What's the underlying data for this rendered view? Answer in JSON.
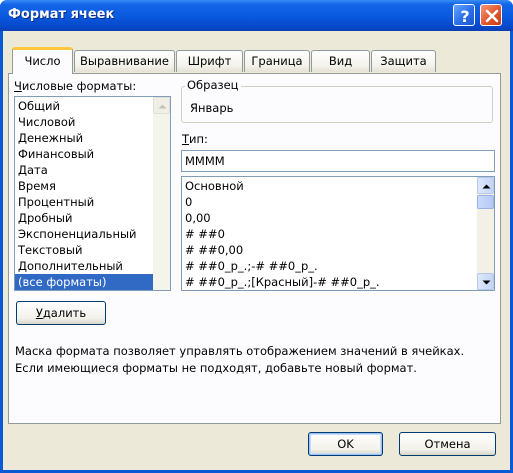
{
  "window": {
    "title": "Формат ячеек"
  },
  "titlebar": {
    "help_icon": "question-mark",
    "close_icon": "x-mark"
  },
  "tabs": [
    {
      "label": "Число",
      "active": true
    },
    {
      "label": "Выравнивание",
      "active": false
    },
    {
      "label": "Шрифт",
      "active": false
    },
    {
      "label": "Граница",
      "active": false
    },
    {
      "label": "Вид",
      "active": false
    },
    {
      "label": "Защита",
      "active": false
    }
  ],
  "number_formats": {
    "label_first": "Ч",
    "label_rest": "исловые форматы:",
    "items": [
      "Общий",
      "Числовой",
      "Денежный",
      "Финансовый",
      "Дата",
      "Время",
      "Процентный",
      "Дробный",
      "Экспоненциальный",
      "Текстовый",
      "Дополнительный",
      "(все форматы)"
    ],
    "selected": "(все форматы)"
  },
  "sample": {
    "title": "Образец",
    "value": "Январь"
  },
  "type": {
    "label_first": "Т",
    "label_rest": "ип:",
    "value": "ММММ",
    "items": [
      "Основной",
      "0",
      "0,00",
      "# ##0",
      "# ##0,00",
      "# ##0_р_.;-# ##0_р_.",
      "# ##0_р_.;[Красный]-# ##0_р_."
    ]
  },
  "delete_button": {
    "label_first": "У",
    "label_rest": "далить"
  },
  "description": "Маска формата позволяет управлять отображением значений в ячейках. Если имеющиеся форматы не подходят, добавьте новый формат.",
  "footer": {
    "ok_label": "OK",
    "cancel_label": "Отмена"
  },
  "colors": {
    "titlebar": "#0a58de",
    "dialog_bg": "#ece9d8",
    "selection": "#316ac5",
    "active_tab_accent": "#ffc83c"
  }
}
